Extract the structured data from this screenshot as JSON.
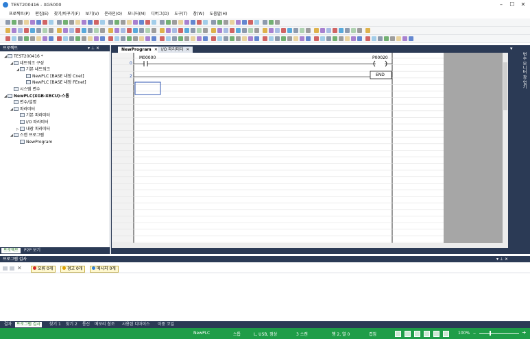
{
  "window": {
    "title": "TEST200416 - XG5000",
    "minimize": "–",
    "maximize": "☐",
    "close": "✕"
  },
  "menu": [
    "프로젝트(P)",
    "편집(E)",
    "찾기/바꾸기(F)",
    "보기(V)",
    "온라인(O)",
    "모니터(M)",
    "디버그(D)",
    "도구(T)",
    "창(W)",
    "도움말(H)"
  ],
  "project_panel": {
    "title": "프로젝트",
    "controls": "▾ ⊥ ✕",
    "tree": [
      {
        "label": "TEST200416 *",
        "indent": 0,
        "arrow": "◢",
        "bold": false
      },
      {
        "label": "네트워크 구성",
        "indent": 1,
        "arrow": "◢",
        "bold": false
      },
      {
        "label": "기본 네트워크",
        "indent": 2,
        "arrow": "◢",
        "bold": false
      },
      {
        "label": "NewPLC [BASE 내장 Cnet]",
        "indent": 3,
        "arrow": "",
        "bold": false
      },
      {
        "label": "NewPLC [BASE 내장 FEnet]",
        "indent": 3,
        "arrow": "",
        "bold": false
      },
      {
        "label": "시스템 변수",
        "indent": 1,
        "arrow": "",
        "bold": false
      },
      {
        "label": "NewPLC(XGB-XBCU)-스톱",
        "indent": 0,
        "arrow": "◢",
        "bold": true
      },
      {
        "label": "변수/설명",
        "indent": 1,
        "arrow": "",
        "bold": false
      },
      {
        "label": "파라미터",
        "indent": 1,
        "arrow": "◢",
        "bold": false
      },
      {
        "label": "기본 파라미터",
        "indent": 2,
        "arrow": "",
        "bold": false
      },
      {
        "label": "I/O 파라미터",
        "indent": 2,
        "arrow": "",
        "bold": false
      },
      {
        "label": "내장 파라미터",
        "indent": 2,
        "arrow": "▷",
        "bold": false
      },
      {
        "label": "스캔 프로그램",
        "indent": 1,
        "arrow": "◢",
        "bold": false
      },
      {
        "label": "NewProgram",
        "indent": 2,
        "arrow": "",
        "bold": false
      }
    ],
    "tabs": [
      "프로젝트",
      "P2P 보기"
    ]
  },
  "editor": {
    "tabs": [
      {
        "label": "NewProgram",
        "close": "✕"
      },
      {
        "label": "I/O 파라미터",
        "close": "✕"
      }
    ],
    "dropdown": "▾",
    "rungs": [
      {
        "step": "0",
        "contact": "M00000",
        "coil": "P00020"
      },
      {
        "step": "2",
        "end_label": "END"
      }
    ]
  },
  "right_sidebar": {
    "label": "변수 모니터 창 열기"
  },
  "check_panel": {
    "title": "프로그램 검사",
    "controls": "▾ ⊥ ✕",
    "badges": [
      {
        "label": "오류 0개",
        "color": "#d62828"
      },
      {
        "label": "경고 0개",
        "color": "#e0a100"
      },
      {
        "label": "메시지 0개",
        "color": "#2f7fd6"
      }
    ]
  },
  "bottom_tabs": [
    "결과",
    "프로그램 검사",
    "찾기 1",
    "찾기 2",
    "통신",
    "메모리 참조",
    "사용된 디바이스",
    "이중 코일"
  ],
  "status": {
    "plc": "NewPLC",
    "mode": "스톱",
    "connection": "L, USB, 정상",
    "scan": "3 스캔",
    "position": "행 2, 열 0",
    "overwrite": "겹침",
    "zoom": "100%"
  }
}
